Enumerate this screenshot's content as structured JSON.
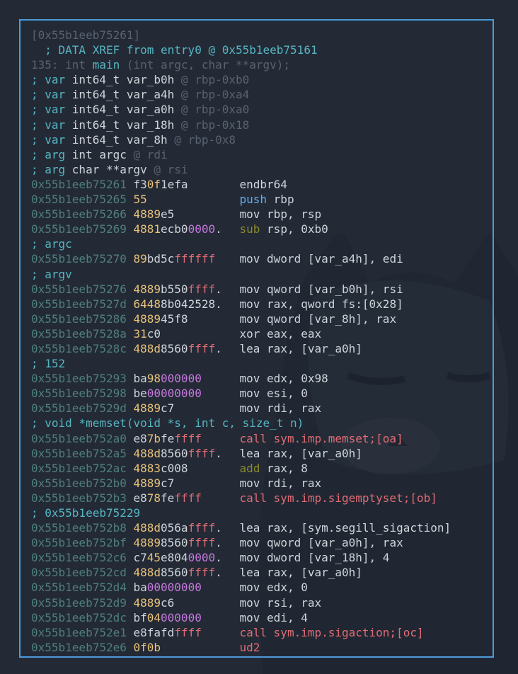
{
  "header": {
    "addr_label": "[0x55b1eeb75261]",
    "xref": "  ; DATA XREF from entry0 @ 0x55b1eeb75161",
    "sig_prefix": "135: int ",
    "sig_name": "main",
    "sig_rest": " (int argc, char **argv);"
  },
  "vars": [
    {
      "kw": "; var ",
      "decl": "int64_t var_b0h ",
      "loc": "@ rbp-0xb0"
    },
    {
      "kw": "; var ",
      "decl": "int64_t var_a4h ",
      "loc": "@ rbp-0xa4"
    },
    {
      "kw": "; var ",
      "decl": "int64_t var_a0h ",
      "loc": "@ rbp-0xa0"
    },
    {
      "kw": "; var ",
      "decl": "int64_t var_18h ",
      "loc": "@ rbp-0x18"
    },
    {
      "kw": "; var ",
      "decl": "int64_t var_8h ",
      "loc": "@ rbp-0x8"
    },
    {
      "kw": "; arg ",
      "decl": "int argc ",
      "loc": "@ rdi"
    },
    {
      "kw": "; arg ",
      "decl": "char **argv ",
      "loc": "@ rsi"
    }
  ],
  "comments": {
    "argc": "; argc",
    "argv": "; argv",
    "c152": "; 152",
    "memset": "; void *memset(void *s, int c, size_t n)",
    "addr229": "; 0x55b1eeb75229"
  },
  "asm": [
    {
      "addr": "0x55b1eeb75261",
      "hex": "f30f1efa",
      "op": "endbr64",
      "args": ""
    },
    {
      "addr": "0x55b1eeb75265",
      "hex": "55",
      "op": "push",
      "args": "rbp"
    },
    {
      "addr": "0x55b1eeb75266",
      "hex": "4889e5",
      "op": "mov",
      "args": "rbp, rsp"
    },
    {
      "addr": "0x55b1eeb75269",
      "hex": "4881ecb00000.",
      "op": "sub",
      "args": "rsp, 0xb0"
    },
    {
      "addr": "0x55b1eeb75270",
      "hex": "89bd5cffffff",
      "op": "mov",
      "args": "dword [var_a4h], edi"
    },
    {
      "addr": "0x55b1eeb75276",
      "hex": "4889b550ffff.",
      "op": "mov",
      "args": "qword [var_b0h], rsi"
    },
    {
      "addr": "0x55b1eeb7527d",
      "hex": "64488b042528.",
      "op": "mov",
      "args": "rax, qword fs:[0x28]"
    },
    {
      "addr": "0x55b1eeb75286",
      "hex": "488945f8",
      "op": "mov",
      "args": "qword [var_8h], rax"
    },
    {
      "addr": "0x55b1eeb7528a",
      "hex": "31c0",
      "op": "xor",
      "args": "eax, eax"
    },
    {
      "addr": "0x55b1eeb7528c",
      "hex": "488d8560ffff.",
      "op": "lea",
      "args": "rax, [var_a0h]"
    },
    {
      "addr": "0x55b1eeb75293",
      "hex": "ba98000000",
      "op": "mov",
      "args": "edx, 0x98"
    },
    {
      "addr": "0x55b1eeb75298",
      "hex": "be00000000",
      "op": "mov",
      "args": "esi, 0"
    },
    {
      "addr": "0x55b1eeb7529d",
      "hex": "4889c7",
      "op": "mov",
      "args": "rdi, rax"
    },
    {
      "addr": "0x55b1eeb752a0",
      "hex": "e87bfeffff",
      "op": "call",
      "args": "sym.imp.memset;[oa]"
    },
    {
      "addr": "0x55b1eeb752a5",
      "hex": "488d8560ffff.",
      "op": "lea",
      "args": "rax, [var_a0h]"
    },
    {
      "addr": "0x55b1eeb752ac",
      "hex": "4883c008",
      "op": "add",
      "args": "rax, 8"
    },
    {
      "addr": "0x55b1eeb752b0",
      "hex": "4889c7",
      "op": "mov",
      "args": "rdi, rax"
    },
    {
      "addr": "0x55b1eeb752b3",
      "hex": "e878feffff",
      "op": "call",
      "args": "sym.imp.sigemptyset;[ob]"
    },
    {
      "addr": "0x55b1eeb752b8",
      "hex": "488d056affff.",
      "op": "lea",
      "args": "rax, [sym.segill_sigaction]"
    },
    {
      "addr": "0x55b1eeb752bf",
      "hex": "48898560ffff.",
      "op": "mov",
      "args": "qword [var_a0h], rax"
    },
    {
      "addr": "0x55b1eeb752c6",
      "hex": "c745e8040000.",
      "op": "mov",
      "args": "dword [var_18h], 4"
    },
    {
      "addr": "0x55b1eeb752cd",
      "hex": "488d8560ffff.",
      "op": "lea",
      "args": "rax, [var_a0h]"
    },
    {
      "addr": "0x55b1eeb752d4",
      "hex": "ba00000000",
      "op": "mov",
      "args": "edx, 0"
    },
    {
      "addr": "0x55b1eeb752d9",
      "hex": "4889c6",
      "op": "mov",
      "args": "rsi, rax"
    },
    {
      "addr": "0x55b1eeb752dc",
      "hex": "bf04000000",
      "op": "mov",
      "args": "edi, 4"
    },
    {
      "addr": "0x55b1eeb752e1",
      "hex": "e8fafdffff",
      "op": "call",
      "args": "sym.imp.sigaction;[oc]"
    },
    {
      "addr": "0x55b1eeb752e6",
      "hex": "0f0b",
      "op": "ud2",
      "args": ""
    }
  ],
  "colors": {
    "background": "#232a36",
    "border": "#4d9bd9",
    "address": "#4f7f7c",
    "comment": "#56b6c2",
    "call": "#e06c75",
    "mov": "#e5c07b"
  },
  "icons": {
    "background": "cat-wallpaper-icon"
  }
}
